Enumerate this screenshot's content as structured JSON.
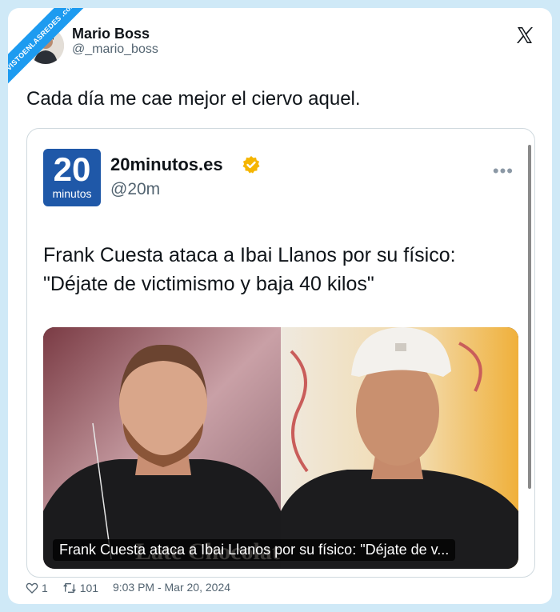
{
  "watermark": "VISTOENLASREDES .com",
  "author": {
    "name": "Mario Boss",
    "handle": "@_mario_boss"
  },
  "tweet": {
    "text": "Cada día me cae mejor el ciervo aquel."
  },
  "quote": {
    "logo_number": "20",
    "logo_word": "minutos",
    "name": "20minutos.es",
    "handle": "@20m",
    "more": "•••",
    "text": "Frank Cuesta ataca a Ibai Llanos por su físico: \"Déjate de victimismo y baja 40 kilos\"",
    "media_caption": "Frank Cuesta ataca a Ibai Llanos por su físico: \"Déjate de v...",
    "shirt_text": "Late Chocolate"
  },
  "footer": {
    "likes": "1",
    "retweets": "101",
    "timestamp": "9:03 PM - Mar 20, 2024"
  },
  "colors": {
    "accent": "#1d9bf0",
    "brand_blue": "#1f58a8",
    "verified": "#f5b500"
  }
}
